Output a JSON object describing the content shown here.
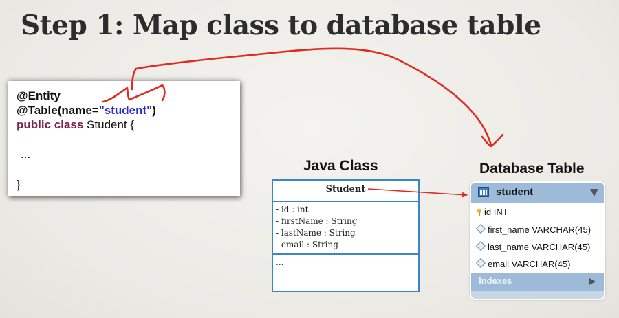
{
  "slide": {
    "title": "Step 1: Map class to database table"
  },
  "code": {
    "entity_annotation": "@Entity",
    "table_prefix": "@Table(name=",
    "table_name_literal": "\"student\"",
    "table_suffix": ")",
    "class_keywords": "public class",
    "class_decl_rest": " Student {",
    "body_placeholder": "...",
    "closing_brace": "}"
  },
  "java_class": {
    "heading": "Java Class",
    "name": "Student",
    "fields": [
      "- id : int",
      "- firstName : String",
      "- lastName : String",
      "- email : String"
    ],
    "methods": "..."
  },
  "database_table": {
    "heading": "Database Table",
    "name": "student",
    "columns": [
      {
        "label": "id INT",
        "icon": "primary-key-icon"
      },
      {
        "label": "first_name VARCHAR(45)",
        "icon": "column-diamond-icon"
      },
      {
        "label": "last_name VARCHAR(45)",
        "icon": "column-diamond-icon"
      },
      {
        "label": "email VARCHAR(45)",
        "icon": "column-diamond-icon"
      }
    ],
    "indexes_label": "Indexes"
  },
  "colors": {
    "annotation_arrow": "#e02a22",
    "uml_border": "#3a86c8",
    "db_header": "#9dbbd8",
    "keyword": "#7a1f4e",
    "string_literal": "#2a2ad0"
  }
}
